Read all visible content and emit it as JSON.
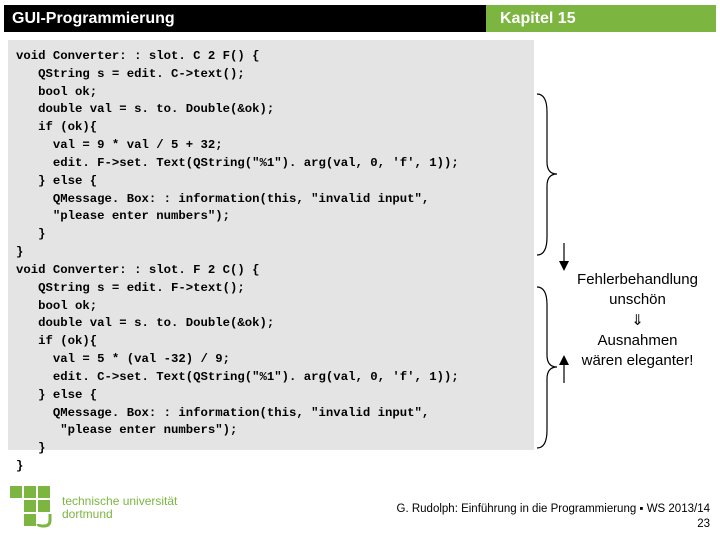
{
  "header": {
    "left": "GUI-Programmierung",
    "right": "Kapitel 15"
  },
  "code": "void Converter: : slot. C 2 F() {\n   QString s = edit. C->text();\n   bool ok;\n   double val = s. to. Double(&ok);\n   if (ok){\n     val = 9 * val / 5 + 32;\n     edit. F->set. Text(QString(\"%1\"). arg(val, 0, 'f', 1));\n   } else {\n     QMessage. Box: : information(this, \"invalid input\",\n     \"please enter numbers\");\n   }\n}\nvoid Converter: : slot. F 2 C() {\n   QString s = edit. F->text();\n   bool ok;\n   double val = s. to. Double(&ok);\n   if (ok){\n     val = 5 * (val -32) / 9;\n     edit. C->set. Text(QString(\"%1\"). arg(val, 0, 'f', 1));\n   } else {\n     QMessage. Box: : information(this, \"invalid input\",\n      \"please enter numbers\");\n   }\n}",
  "annotation": {
    "line1": "Fehlerbehandlung",
    "line2": "unschön",
    "arrow": "⇓",
    "line3": "Ausnahmen",
    "line4": "wären eleganter!"
  },
  "footer": {
    "uni1": "technische universität",
    "uni2": "dortmund",
    "credit": "G. Rudolph: Einführung in die Programmierung ▪ WS 2013/14",
    "page": "23"
  },
  "colors": {
    "accent": "#7cb641"
  }
}
